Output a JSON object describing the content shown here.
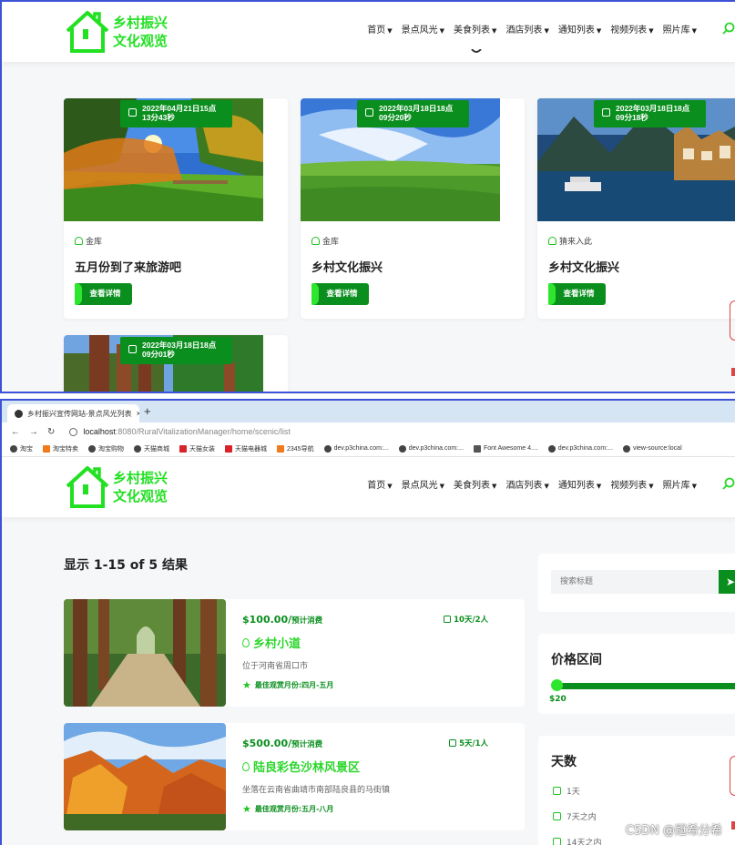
{
  "logo": {
    "line1": "乡村振兴",
    "line2": "文化观览"
  },
  "colors": {
    "brand": "#0a8f1e",
    "accent": "#2bd62b",
    "nav_border": "#3d52d6"
  },
  "nav_top": [
    {
      "label": "首页",
      "active": true
    },
    {
      "label": "景点风光",
      "active": false
    },
    {
      "label": "美食列表",
      "active": false
    },
    {
      "label": "酒店列表",
      "active": false
    },
    {
      "label": "通知列表",
      "active": false
    },
    {
      "label": "视频列表",
      "active": false
    },
    {
      "label": "照片库",
      "active": false
    }
  ],
  "nav_bottom": [
    {
      "label": "首页",
      "active": false
    },
    {
      "label": "景点风光",
      "active": true
    },
    {
      "label": "美食列表",
      "active": false
    },
    {
      "label": "酒店列表",
      "active": false
    },
    {
      "label": "通知列表",
      "active": false
    },
    {
      "label": "视频列表",
      "active": false
    },
    {
      "label": "照片库",
      "active": false
    }
  ],
  "cards": [
    {
      "date_line1": "2022年04月21日15点",
      "date_line2": "13分43秒",
      "author": "金库",
      "title": "五月份到了来旅游吧",
      "button": "查看详情"
    },
    {
      "date_line1": "2022年03月18日18点",
      "date_line2": "09分20秒",
      "author": "金库",
      "title": "乡村文化振兴",
      "button": "查看详情"
    },
    {
      "date_line1": "2022年03月18日18点",
      "date_line2": "09分18秒",
      "author": "猜来入此",
      "title": "乡村文化振兴",
      "button": "查看详情"
    },
    {
      "date_line1": "2022年03月18日18点",
      "date_line2": "09分01秒",
      "author": "",
      "title": "",
      "button": ""
    }
  ],
  "browser": {
    "tab_title": "乡村振兴宣传网站-景点风光列表",
    "tab_close": "×",
    "new_tab": "+",
    "url_host": "localhost",
    "url_path": ":8080/RuralVitalizationManager/home/scenic/list",
    "bookmarks": [
      "淘宝",
      "淘宝特卖",
      "淘宝购物",
      "天猫商城",
      "天猫女装",
      "天猫电器城",
      "2345导航",
      "dev.p3china.com:...",
      "dev.p3china.com:...",
      "Font Awesome 4....",
      "dev.p3china.com:...",
      "view-source:local"
    ]
  },
  "results_label": "显示 1-15 of 5 结果",
  "scenic_list": [
    {
      "price": "$100.00/",
      "price_note": "预计消费",
      "days": "10天/2人",
      "name": "乡村小道",
      "desc": "位于河南省周口市",
      "season": "最佳观赏月份:四月-五月"
    },
    {
      "price": "$500.00/",
      "price_note": "预计消费",
      "days": "5天/1人",
      "name": "陆良彩色沙林风景区",
      "desc": "坐落在云南省曲靖市南部陆良县的马街镇",
      "season": "最佳观赏月份:五月-八月"
    }
  ],
  "sidebar": {
    "search_placeholder": "搜索标题",
    "price_title": "价格区间",
    "price_min": 20,
    "price_value": "$20",
    "days_title": "天数",
    "day_options": [
      "1天",
      "7天之内",
      "14天之内"
    ]
  },
  "watermark": "CSDN @冠希分希"
}
